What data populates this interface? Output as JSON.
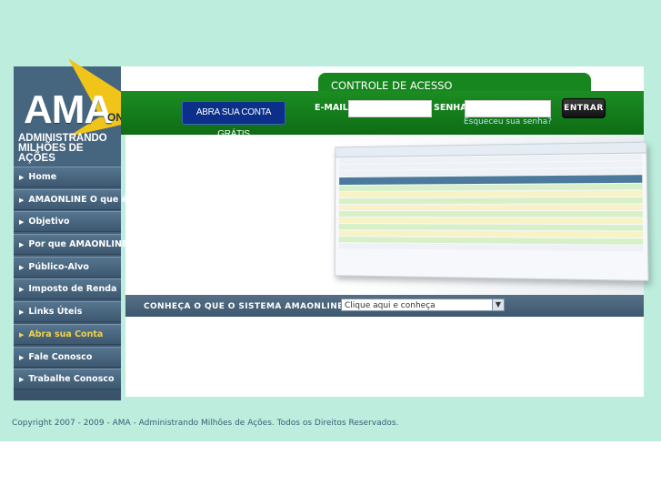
{
  "logo": {
    "brand": "AMA",
    "suffix": "ONLINE",
    "tagline_line1": "ADMINISTRANDO",
    "tagline_line2": "MILHÕES DE AÇÕES"
  },
  "sidebar": {
    "items": [
      {
        "label": "Home",
        "active": false
      },
      {
        "label": "AMAONLINE O que é?",
        "active": false
      },
      {
        "label": "Objetivo",
        "active": false
      },
      {
        "label": "Por que AMAONLINE?",
        "active": false
      },
      {
        "label": "Público-Alvo",
        "active": false
      },
      {
        "label": "Imposto de Renda",
        "active": false
      },
      {
        "label": "Links Úteis",
        "active": false
      },
      {
        "label": "Abra sua Conta",
        "active": true
      },
      {
        "label": "Fale Conosco",
        "active": false
      },
      {
        "label": "Trabalhe Conosco",
        "active": false
      }
    ]
  },
  "header": {
    "access_title": "CONTROLE DE ACESSO",
    "signup_label": "ABRA SUA CONTA GRÁTIS",
    "email_label": "E-MAIL:",
    "email_value": "",
    "senha_label": "SENHA:",
    "senha_value": "",
    "login_label": "ENTRAR",
    "forgot_label": "Esqueceu sua senha?"
  },
  "feature": {
    "prompt": "CONHEÇA O QUE O SISTEMA AMAONLINE OFERECE:",
    "select_value": "Clique aqui e conheça"
  },
  "footer": {
    "copyright": "Copyright 2007 - 2009 - AMA - Administrando Milhões de Ações. Todos os Direitos Reservados."
  },
  "colors": {
    "background": "#bdeedd",
    "header_green": "#138019",
    "sidebar_blue": "#46657f",
    "accent_yellow": "#f0c419",
    "signup_blue": "#0c2f8a"
  }
}
